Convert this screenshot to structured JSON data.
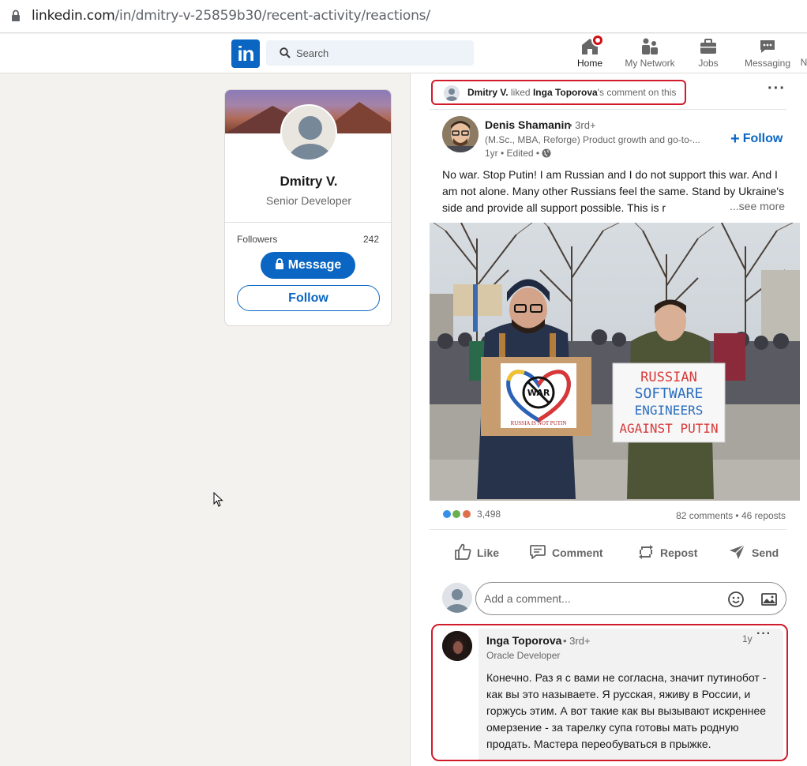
{
  "browser": {
    "url_host": "linkedin.com",
    "url_path": "/in/dmitry-v-25859b30/recent-activity/reactions/"
  },
  "nav": {
    "search_placeholder": "Search",
    "items": [
      {
        "label": "Home",
        "icon": "home-icon"
      },
      {
        "label": "My Network",
        "icon": "network-icon"
      },
      {
        "label": "Jobs",
        "icon": "briefcase-icon"
      },
      {
        "label": "Messaging",
        "icon": "messaging-icon"
      },
      {
        "label": "N"
      }
    ]
  },
  "profile": {
    "name": "Dmitry V.",
    "title": "Senior Developer",
    "followers_label": "Followers",
    "followers_count": "242",
    "message_label": "Message",
    "follow_label": "Follow"
  },
  "activity": {
    "actor": "Dmitry V.",
    "verb": " liked ",
    "target": "Inga Toporova",
    "suffix": "'s comment on this"
  },
  "post": {
    "author": "Denis Shamanin",
    "degree": "• 3rd+",
    "headline": "(M.Sc., MBA, Reforge) Product growth and go-to-...",
    "meta": "1yr • Edited •",
    "follow_label": "Follow",
    "text": "No war. Stop Putin! I am Russian and I do not support this war. And I am not alone. Many other Russians feel the same. Stand by Ukraine's side and provide all support possible. This is r",
    "see_more": "...see more",
    "sign_left_word": "WAR",
    "sign_left_caption": "RUSSIA IS NOT PUTIN",
    "sign_right_lines": [
      "RUSSIAN",
      "SOFTWARE",
      "ENGINEERS",
      "AGAINST PUTIN"
    ],
    "reactions_count": "3,498",
    "comments_reposts": "82 comments • 46 reposts",
    "actions": {
      "like": "Like",
      "comment": "Comment",
      "repost": "Repost",
      "send": "Send"
    },
    "comment_placeholder": "Add a comment..."
  },
  "comment": {
    "author": "Inga Toporova",
    "degree": "• 3rd+",
    "headline": "Oracle Developer",
    "time": "1y",
    "text": "Конечно. Раз я с вами не согласна, значит путинобот - как вы это называете. Я русская, яживу в России, и горжусь этим. А вот такие как вы вызывают искреннее омерзение - за тарелку супа готовы мать родную продать. Мастера переобуваться в прыжке."
  },
  "colors": {
    "brand": "#0a66c2",
    "highlight": "#d11a2a",
    "page_bg": "#f3f2ef"
  }
}
